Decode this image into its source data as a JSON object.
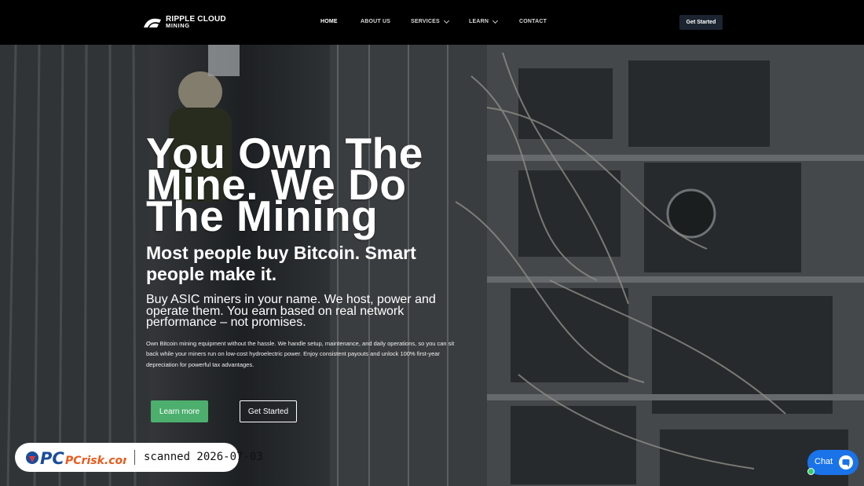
{
  "header": {
    "logo": {
      "line1": "RIPPLE CLOUD",
      "line2": "MINING"
    },
    "nav": [
      {
        "label": "HOME",
        "active": true,
        "dropdown": false
      },
      {
        "label": "ABOUT US",
        "active": false,
        "dropdown": false
      },
      {
        "label": "SERVICES",
        "active": false,
        "dropdown": true
      },
      {
        "label": "LEARN",
        "active": false,
        "dropdown": true
      },
      {
        "label": "CONTACT",
        "active": false,
        "dropdown": false
      }
    ],
    "cta_label": "Get Started"
  },
  "hero": {
    "headline": "You Own The Mine. We Do The Mining",
    "subhead": "Most people buy Bitcoin. Smart people make it.",
    "tagline": "Buy ASIC miners in your name. We host, power and operate them. You earn based on real network performance – not promises.",
    "body": "Own Bitcoin mining equipment without the hassle. We handle setup, maintenance, and daily operations, so you can sit back while your miners run on low-cost hydroelectric power. Enjoy consistent payouts and unlock 100% first-year depreciation for powerful tax advantages.",
    "learn_more_label": "Learn more",
    "get_started_label": "Get Started"
  },
  "watermark": {
    "brand": "PCrisk.com",
    "scan_text": "scanned 2026-07-03"
  },
  "chat": {
    "label": "Chat"
  },
  "colors": {
    "accent_green": "#4caf6e",
    "header_bg": "#000000",
    "chat_blue": "#1a73e8",
    "cta_dark": "#1b2430"
  }
}
